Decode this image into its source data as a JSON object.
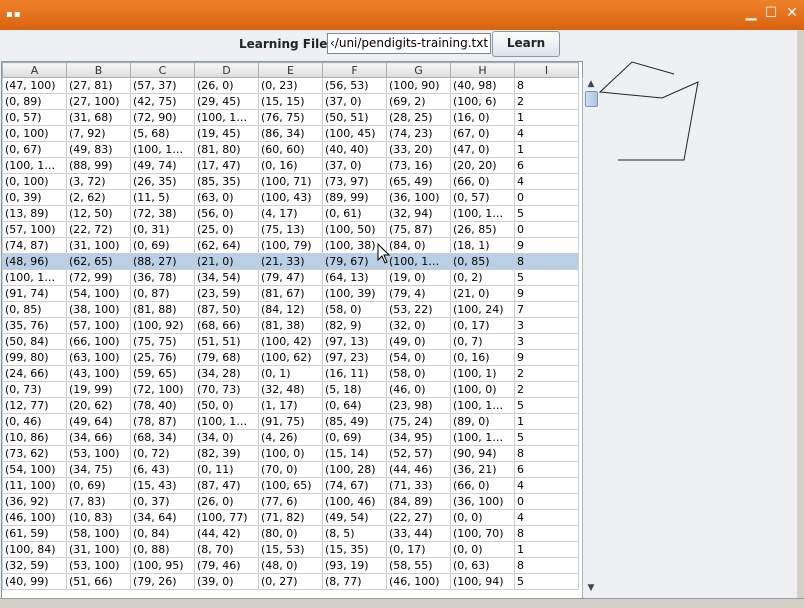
{
  "window": {
    "title": ""
  },
  "form": {
    "learning_file_label": "Learning File:",
    "learning_file_value": "‹/uni/pendigits-training.txt",
    "learn_button": "Learn"
  },
  "table": {
    "columns": [
      "A",
      "B",
      "C",
      "D",
      "E",
      "F",
      "G",
      "H",
      "I"
    ],
    "selected_row": 11,
    "rows": [
      [
        "(47, 100)",
        "(27, 81)",
        "(57, 37)",
        "(26, 0)",
        "(0, 23)",
        "(56, 53)",
        "(100, 90)",
        "(40, 98)",
        "8"
      ],
      [
        "(0, 89)",
        "(27, 100)",
        "(42, 75)",
        "(29, 45)",
        "(15, 15)",
        "(37, 0)",
        "(69, 2)",
        "(100, 6)",
        "2"
      ],
      [
        "(0, 57)",
        "(31, 68)",
        "(72, 90)",
        "(100, 1…",
        "(76, 75)",
        "(50, 51)",
        "(28, 25)",
        "(16, 0)",
        "1"
      ],
      [
        "(0, 100)",
        "(7, 92)",
        "(5, 68)",
        "(19, 45)",
        "(86, 34)",
        "(100, 45)",
        "(74, 23)",
        "(67, 0)",
        "4"
      ],
      [
        "(0, 67)",
        "(49, 83)",
        "(100, 1…",
        "(81, 80)",
        "(60, 60)",
        "(40, 40)",
        "(33, 20)",
        "(47, 0)",
        "1"
      ],
      [
        "(100, 1…",
        "(88, 99)",
        "(49, 74)",
        "(17, 47)",
        "(0, 16)",
        "(37, 0)",
        "(73, 16)",
        "(20, 20)",
        "6"
      ],
      [
        "(0, 100)",
        "(3, 72)",
        "(26, 35)",
        "(85, 35)",
        "(100, 71)",
        "(73, 97)",
        "(65, 49)",
        "(66, 0)",
        "4"
      ],
      [
        "(0, 39)",
        "(2, 62)",
        "(11, 5)",
        "(63, 0)",
        "(100, 43)",
        "(89, 99)",
        "(36, 100)",
        "(0, 57)",
        "0"
      ],
      [
        "(13, 89)",
        "(12, 50)",
        "(72, 38)",
        "(56, 0)",
        "(4, 17)",
        "(0, 61)",
        "(32, 94)",
        "(100, 1…",
        "5"
      ],
      [
        "(57, 100)",
        "(22, 72)",
        "(0, 31)",
        "(25, 0)",
        "(75, 13)",
        "(100, 50)",
        "(75, 87)",
        "(26, 85)",
        "0"
      ],
      [
        "(74, 87)",
        "(31, 100)",
        "(0, 69)",
        "(62, 64)",
        "(100, 79)",
        "(100, 38)",
        "(84, 0)",
        "(18, 1)",
        "9"
      ],
      [
        "(48, 96)",
        "(62, 65)",
        "(88, 27)",
        "(21, 0)",
        "(21, 33)",
        "(79, 67)",
        "(100, 1…",
        "(0, 85)",
        "8"
      ],
      [
        "(100, 1…",
        "(72, 99)",
        "(36, 78)",
        "(34, 54)",
        "(79, 47)",
        "(64, 13)",
        "(19, 0)",
        "(0, 2)",
        "5"
      ],
      [
        "(91, 74)",
        "(54, 100)",
        "(0, 87)",
        "(23, 59)",
        "(81, 67)",
        "(100, 39)",
        "(79, 4)",
        "(21, 0)",
        "9"
      ],
      [
        "(0, 85)",
        "(38, 100)",
        "(81, 88)",
        "(87, 50)",
        "(84, 12)",
        "(58, 0)",
        "(53, 22)",
        "(100, 24)",
        "7"
      ],
      [
        "(35, 76)",
        "(57, 100)",
        "(100, 92)",
        "(68, 66)",
        "(81, 38)",
        "(82, 9)",
        "(32, 0)",
        "(0, 17)",
        "3"
      ],
      [
        "(50, 84)",
        "(66, 100)",
        "(75, 75)",
        "(51, 51)",
        "(100, 42)",
        "(97, 13)",
        "(49, 0)",
        "(0, 7)",
        "3"
      ],
      [
        "(99, 80)",
        "(63, 100)",
        "(25, 76)",
        "(79, 68)",
        "(100, 62)",
        "(97, 23)",
        "(54, 0)",
        "(0, 16)",
        "9"
      ],
      [
        "(24, 66)",
        "(43, 100)",
        "(59, 65)",
        "(34, 28)",
        "(0, 1)",
        "(16, 11)",
        "(58, 0)",
        "(100, 1)",
        "2"
      ],
      [
        "(0, 73)",
        "(19, 99)",
        "(72, 100)",
        "(70, 73)",
        "(32, 48)",
        "(5, 18)",
        "(46, 0)",
        "(100, 0)",
        "2"
      ],
      [
        "(12, 77)",
        "(20, 62)",
        "(78, 40)",
        "(50, 0)",
        "(1, 17)",
        "(0, 64)",
        "(23, 98)",
        "(100, 1…",
        "5"
      ],
      [
        "(0, 46)",
        "(49, 64)",
        "(78, 87)",
        "(100, 1…",
        "(91, 75)",
        "(85, 49)",
        "(75, 24)",
        "(89, 0)",
        "1"
      ],
      [
        "(10, 86)",
        "(34, 66)",
        "(68, 34)",
        "(34, 0)",
        "(4, 26)",
        "(0, 69)",
        "(34, 95)",
        "(100, 1…",
        "5"
      ],
      [
        "(73, 62)",
        "(53, 100)",
        "(0, 72)",
        "(82, 39)",
        "(100, 0)",
        "(15, 14)",
        "(52, 57)",
        "(90, 94)",
        "8"
      ],
      [
        "(54, 100)",
        "(34, 75)",
        "(6, 43)",
        "(0, 11)",
        "(70, 0)",
        "(100, 28)",
        "(44, 46)",
        "(36, 21)",
        "6"
      ],
      [
        "(11, 100)",
        "(0, 69)",
        "(15, 43)",
        "(87, 47)",
        "(100, 65)",
        "(74, 67)",
        "(71, 33)",
        "(66, 0)",
        "4"
      ],
      [
        "(36, 92)",
        "(7, 83)",
        "(0, 37)",
        "(26, 0)",
        "(77, 6)",
        "(100, 46)",
        "(84, 89)",
        "(36, 100)",
        "0"
      ],
      [
        "(46, 100)",
        "(10, 83)",
        "(34, 64)",
        "(100, 77)",
        "(71, 82)",
        "(49, 54)",
        "(22, 27)",
        "(0, 0)",
        "4"
      ],
      [
        "(61, 59)",
        "(58, 100)",
        "(0, 84)",
        "(44, 42)",
        "(80, 0)",
        "(8, 5)",
        "(33, 44)",
        "(100, 70)",
        "8"
      ],
      [
        "(100, 84)",
        "(31, 100)",
        "(0, 88)",
        "(8, 70)",
        "(15, 53)",
        "(15, 35)",
        "(0, 17)",
        "(0, 0)",
        "1"
      ],
      [
        "(32, 59)",
        "(53, 100)",
        "(100, 95)",
        "(79, 46)",
        "(48, 0)",
        "(93, 19)",
        "(58, 55)",
        "(0, 63)",
        "8"
      ],
      [
        "(40, 99)",
        "(51, 66)",
        "(79, 26)",
        "(39, 0)",
        "(0, 27)",
        "(8, 77)",
        "(46, 100)",
        "(100, 94)",
        "5"
      ]
    ]
  },
  "colors": {
    "titlebar": "#e87420",
    "selection": "#b8cfe5"
  },
  "icons": {
    "grip": "window-grip-icon",
    "minimize": "minimize-icon",
    "maximize": "maximize-icon",
    "close": "close-icon"
  }
}
